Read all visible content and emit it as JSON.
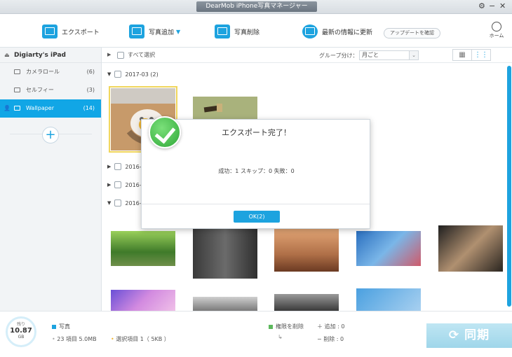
{
  "window": {
    "title": "DearMob iPhone写真マネージャー",
    "settings_glyph": "⚙",
    "minimize_glyph": "−",
    "close_glyph": "✕"
  },
  "toolbar": {
    "export_label": "エクスポート",
    "add_label": "写真追加",
    "delete_label": "写真削除",
    "refresh_label": "最新の情報に更新",
    "update_label": "アップデートを確認",
    "home_label": "ホーム"
  },
  "sidebar": {
    "device_name": "Digiarty's iPad",
    "items": [
      {
        "label": "カメラロール",
        "count": "(6)"
      },
      {
        "label": "セルフィー",
        "count": "(3)"
      },
      {
        "label": "Wallpaper",
        "count": "(14)"
      }
    ]
  },
  "main": {
    "select_all": "すべて選択",
    "group_by_label": "グループ分け：",
    "group_by_value": "月ごと",
    "groups": [
      {
        "label": "2017-03  (2)"
      },
      {
        "label": "2016-"
      },
      {
        "label": "2016-"
      },
      {
        "label": "2016-"
      }
    ]
  },
  "bottom": {
    "storage_remaining_label": "残り",
    "storage_value": "10.87",
    "storage_unit": "GB",
    "category": "写真",
    "items_summary": "23 項目 5.0MB",
    "selected_summary": "選択項目 1（ 5KB ）",
    "delete_perm": "権限を削除",
    "added": "＋ 追加 :  0",
    "removed": "−  削除 :  0",
    "sync": "同期"
  },
  "dialog": {
    "title": "エクスポート完了！",
    "message": "成功：1   スキップ：0   失敗：0",
    "ok_label": "OK(2)"
  },
  "colors": {
    "accent": "#1da3df",
    "selected_outline": "#f0d65c",
    "success_green": "#2fa838"
  }
}
